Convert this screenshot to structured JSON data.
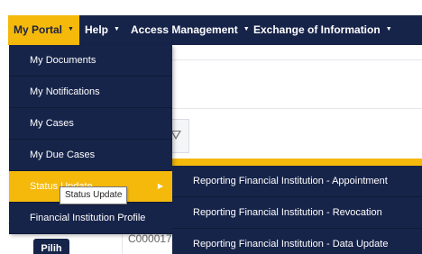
{
  "navbar": {
    "items": [
      {
        "label": "My Portal",
        "active": true
      },
      {
        "label": "Help",
        "active": false
      },
      {
        "label": "Access Management",
        "active": false
      },
      {
        "label": "Exchange of Information",
        "active": false
      }
    ],
    "caret_glyph": "▼"
  },
  "dropdown": {
    "items": [
      {
        "label": "My Documents"
      },
      {
        "label": "My Notifications"
      },
      {
        "label": "My Cases"
      },
      {
        "label": "My Due Cases"
      },
      {
        "label": "Status Update",
        "highlighted": true,
        "has_submenu": true
      },
      {
        "label": "Financial Institution Profile"
      }
    ],
    "submenu_arrow_glyph": "▶"
  },
  "submenu": {
    "items": [
      {
        "label": "Reporting Financial Institution - Appointment"
      },
      {
        "label": "Reporting Financial Institution - Revocation"
      },
      {
        "label": "Reporting Financial Institution - Data Update"
      }
    ]
  },
  "tooltip": {
    "text": "Status Update"
  },
  "table": {
    "row_button_label": "Pilih",
    "row_case_id": "C000017"
  },
  "icons": {
    "filter": "filter-icon"
  },
  "colors": {
    "nav_background": "#17244a",
    "accent": "#f5b90b",
    "text_on_dark": "#ffffff"
  }
}
